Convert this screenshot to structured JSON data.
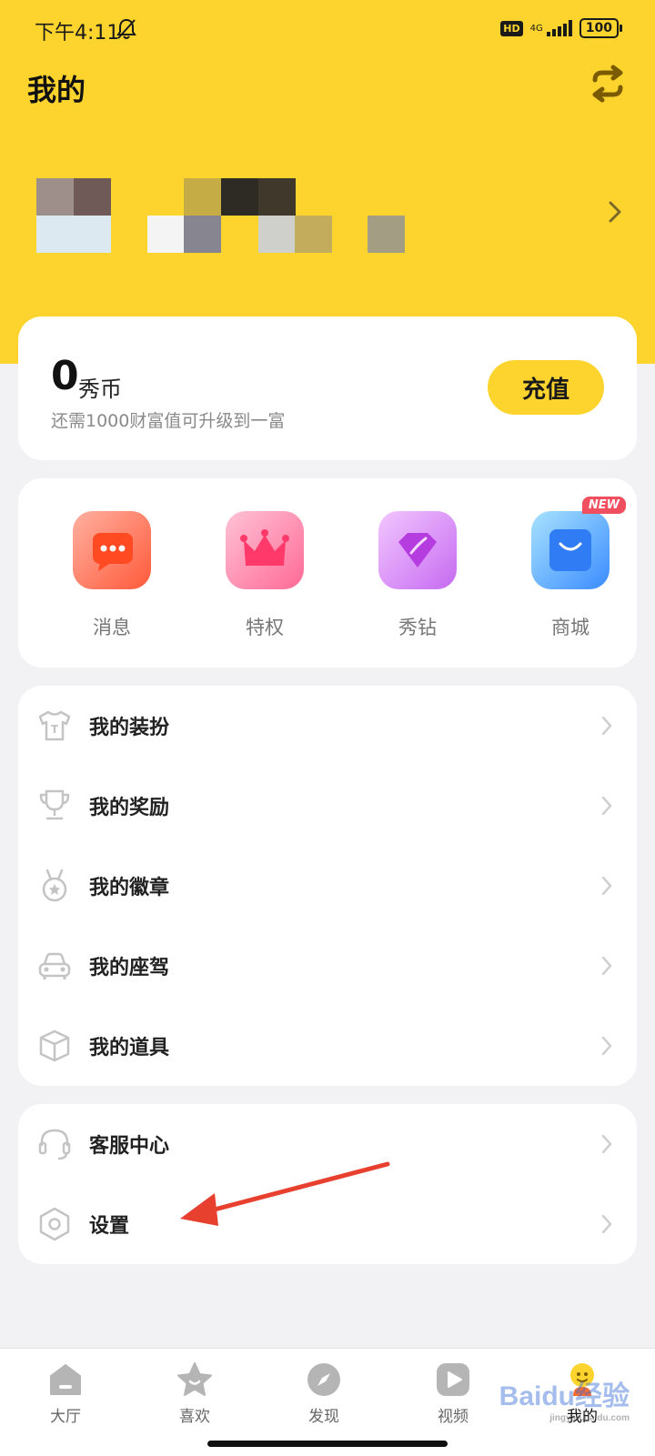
{
  "status_bar": {
    "time": "下午4:11",
    "hd": "HD",
    "network": "4G",
    "battery": "100"
  },
  "header": {
    "title": "我的"
  },
  "coins": {
    "amount": "0",
    "unit": "秀币",
    "hint": "还需1000财富值可升级到一富",
    "recharge_label": "充值"
  },
  "quick_actions": [
    {
      "label": "消息",
      "icon": "message-icon"
    },
    {
      "label": "特权",
      "icon": "crown-icon"
    },
    {
      "label": "秀钻",
      "icon": "diamond-icon"
    },
    {
      "label": "商城",
      "icon": "shopping-bag-icon",
      "badge": "NEW"
    }
  ],
  "menu_group1": [
    {
      "label": "我的装扮",
      "icon": "tshirt-icon"
    },
    {
      "label": "我的奖励",
      "icon": "trophy-icon"
    },
    {
      "label": "我的徽章",
      "icon": "medal-icon"
    },
    {
      "label": "我的座驾",
      "icon": "car-icon"
    },
    {
      "label": "我的道具",
      "icon": "box-icon"
    }
  ],
  "menu_group2": [
    {
      "label": "客服中心",
      "icon": "headset-icon"
    },
    {
      "label": "设置",
      "icon": "settings-icon"
    }
  ],
  "tab_bar": [
    {
      "label": "大厅",
      "icon": "home-icon"
    },
    {
      "label": "喜欢",
      "icon": "star-icon"
    },
    {
      "label": "发现",
      "icon": "compass-icon"
    },
    {
      "label": "视频",
      "icon": "play-icon"
    },
    {
      "label": "我的",
      "icon": "profile-icon",
      "active": true
    }
  ],
  "watermark": {
    "text": "Baidu经验",
    "sub": "jingyan.baidu.com"
  },
  "colors": {
    "accent": "#fdd42e",
    "background": "#f2f2f5",
    "new_badge": "#f04f5f",
    "annotation_arrow": "#e8402f"
  }
}
